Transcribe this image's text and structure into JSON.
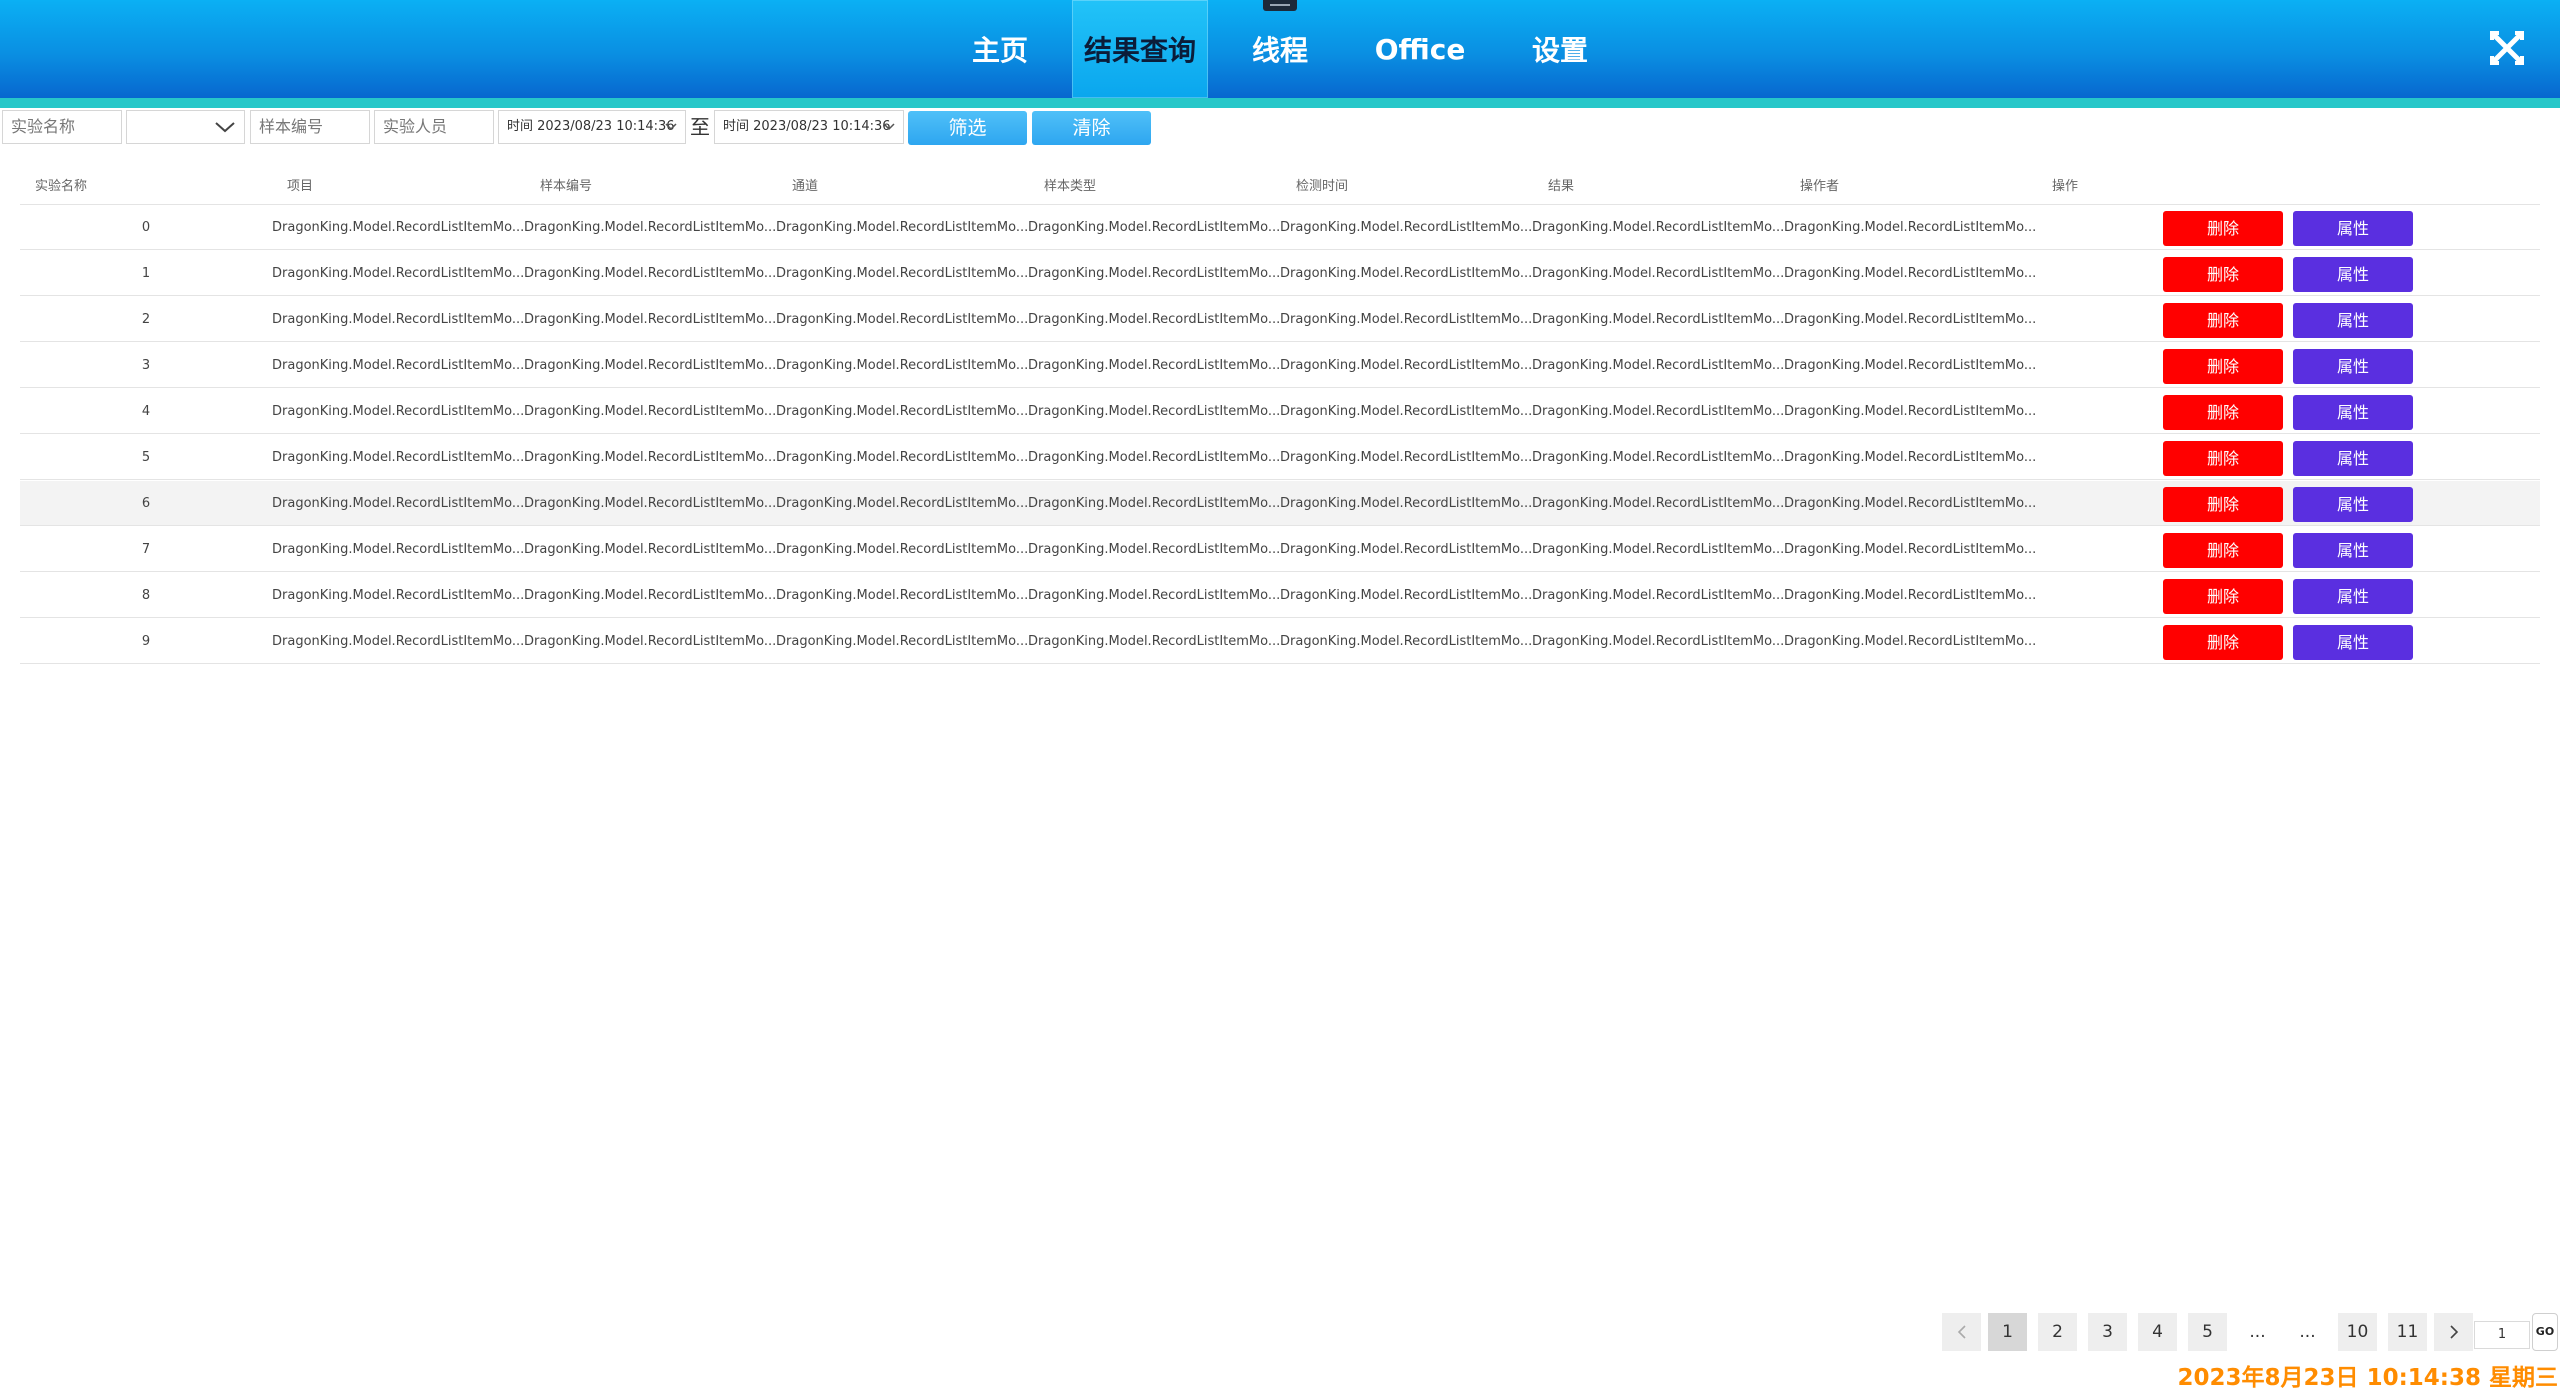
{
  "nav": {
    "tabs": [
      "主页",
      "结果查询",
      "线程",
      "Office",
      "设置"
    ],
    "active": "结果查询"
  },
  "filter": {
    "experiment_name_placeholder": "实验名称",
    "dropdown_value": "",
    "sample_no_placeholder": "样本编号",
    "operator_placeholder": "实验人员",
    "date_from": "时间 2023/08/23 10:14:36",
    "to_label": "至",
    "date_to": "时间 2023/08/23 10:14:36",
    "filter_label": "筛选",
    "clear_label": "清除"
  },
  "table": {
    "headers": [
      "实验名称",
      "项目",
      "样本编号",
      "通道",
      "样本类型",
      "检测时间",
      "结果",
      "操作者",
      "操作"
    ],
    "rows": [
      {
        "index": "0",
        "cells": [
          "DragonKing.Model.RecordListItemMo...",
          "DragonKing.Model.RecordListItemMo...",
          "DragonKing.Model.RecordListItemMo...",
          "DragonKing.Model.RecordListItemMo...",
          "DragonKing.Model.RecordListItemMo...",
          "DragonKing.Model.RecordListItemMo...",
          "DragonKing.Model.RecordListItemMo..."
        ]
      },
      {
        "index": "1",
        "cells": [
          "DragonKing.Model.RecordListItemMo...",
          "DragonKing.Model.RecordListItemMo...",
          "DragonKing.Model.RecordListItemMo...",
          "DragonKing.Model.RecordListItemMo...",
          "DragonKing.Model.RecordListItemMo...",
          "DragonKing.Model.RecordListItemMo...",
          "DragonKing.Model.RecordListItemMo..."
        ]
      },
      {
        "index": "2",
        "cells": [
          "DragonKing.Model.RecordListItemMo...",
          "DragonKing.Model.RecordListItemMo...",
          "DragonKing.Model.RecordListItemMo...",
          "DragonKing.Model.RecordListItemMo...",
          "DragonKing.Model.RecordListItemMo...",
          "DragonKing.Model.RecordListItemMo...",
          "DragonKing.Model.RecordListItemMo..."
        ]
      },
      {
        "index": "3",
        "cells": [
          "DragonKing.Model.RecordListItemMo...",
          "DragonKing.Model.RecordListItemMo...",
          "DragonKing.Model.RecordListItemMo...",
          "DragonKing.Model.RecordListItemMo...",
          "DragonKing.Model.RecordListItemMo...",
          "DragonKing.Model.RecordListItemMo...",
          "DragonKing.Model.RecordListItemMo..."
        ]
      },
      {
        "index": "4",
        "cells": [
          "DragonKing.Model.RecordListItemMo...",
          "DragonKing.Model.RecordListItemMo...",
          "DragonKing.Model.RecordListItemMo...",
          "DragonKing.Model.RecordListItemMo...",
          "DragonKing.Model.RecordListItemMo...",
          "DragonKing.Model.RecordListItemMo...",
          "DragonKing.Model.RecordListItemMo..."
        ]
      },
      {
        "index": "5",
        "cells": [
          "DragonKing.Model.RecordListItemMo...",
          "DragonKing.Model.RecordListItemMo...",
          "DragonKing.Model.RecordListItemMo...",
          "DragonKing.Model.RecordListItemMo...",
          "DragonKing.Model.RecordListItemMo...",
          "DragonKing.Model.RecordListItemMo...",
          "DragonKing.Model.RecordListItemMo..."
        ]
      },
      {
        "index": "6",
        "cells": [
          "DragonKing.Model.RecordListItemMo...",
          "DragonKing.Model.RecordListItemMo...",
          "DragonKing.Model.RecordListItemMo...",
          "DragonKing.Model.RecordListItemMo...",
          "DragonKing.Model.RecordListItemMo...",
          "DragonKing.Model.RecordListItemMo...",
          "DragonKing.Model.RecordListItemMo..."
        ]
      },
      {
        "index": "7",
        "cells": [
          "DragonKing.Model.RecordListItemMo...",
          "DragonKing.Model.RecordListItemMo...",
          "DragonKing.Model.RecordListItemMo...",
          "DragonKing.Model.RecordListItemMo...",
          "DragonKing.Model.RecordListItemMo...",
          "DragonKing.Model.RecordListItemMo...",
          "DragonKing.Model.RecordListItemMo..."
        ]
      },
      {
        "index": "8",
        "cells": [
          "DragonKing.Model.RecordListItemMo...",
          "DragonKing.Model.RecordListItemMo...",
          "DragonKing.Model.RecordListItemMo...",
          "DragonKing.Model.RecordListItemMo...",
          "DragonKing.Model.RecordListItemMo...",
          "DragonKing.Model.RecordListItemMo...",
          "DragonKing.Model.RecordListItemMo..."
        ]
      },
      {
        "index": "9",
        "cells": [
          "DragonKing.Model.RecordListItemMo...",
          "DragonKing.Model.RecordListItemMo...",
          "DragonKing.Model.RecordListItemMo...",
          "DragonKing.Model.RecordListItemMo...",
          "DragonKing.Model.RecordListItemMo...",
          "DragonKing.Model.RecordListItemMo...",
          "DragonKing.Model.RecordListItemMo..."
        ]
      }
    ],
    "highlighted_row": 6,
    "delete_label": "删除",
    "property_label": "属性"
  },
  "pager": {
    "prev_icon": "chevron-left-icon",
    "pages": [
      "1",
      "2",
      "3",
      "4",
      "5",
      "...",
      "...",
      "10",
      "11"
    ],
    "current": "1",
    "next_icon": "chevron-right-icon",
    "jump_value": "1",
    "go_label": "GO"
  },
  "status": {
    "datetime": "2023年8月23日 10:14:38 星期三"
  },
  "colors": {
    "header_top": "#0bb0f4",
    "header_bottom": "#0767cf",
    "accent_stripe": "#27c7c9",
    "delete_red": "#ff0000",
    "property_purple": "#5a2fe0",
    "clock_orange": "#ff8c00"
  }
}
